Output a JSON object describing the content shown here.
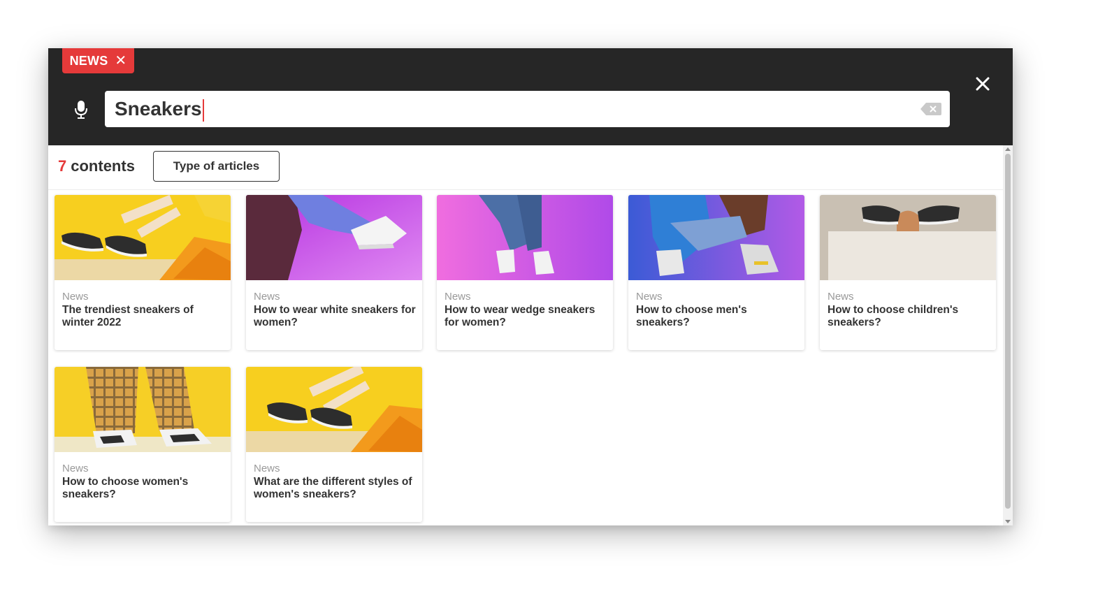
{
  "filter_chip": {
    "label": "NEWS",
    "remove_glyph": "✕"
  },
  "search": {
    "value": "Sneakers"
  },
  "results": {
    "count": "7",
    "count_label": "contents",
    "filter_label": "Type of articles"
  },
  "colors": {
    "accent": "#e53a3a",
    "topbar": "#262626"
  },
  "icons": [
    "microphone-icon",
    "clear-input-icon",
    "close-icon",
    "remove-filter-icon"
  ],
  "cards": [
    {
      "category": "News",
      "title": "The trendiest sneakers of winter 2022",
      "image": "yellow"
    },
    {
      "category": "News",
      "title": "How to wear white sneakers for women?",
      "image": "purple"
    },
    {
      "category": "News",
      "title": "How to wear wedge sneakers for women?",
      "image": "pink"
    },
    {
      "category": "News",
      "title": "How to choose men's sneakers?",
      "image": "blue"
    },
    {
      "category": "News",
      "title": "How to choose children's sneakers?",
      "image": "beige"
    },
    {
      "category": "News",
      "title": "How to choose women's sneakers?",
      "image": "plaid"
    },
    {
      "category": "News",
      "title": "What are the different styles of women's sneakers?",
      "image": "yellow2"
    }
  ]
}
